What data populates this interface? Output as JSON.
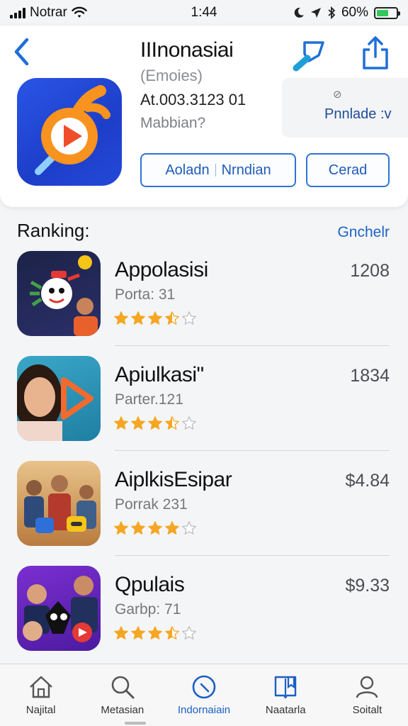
{
  "status": {
    "carrier": "Notrar",
    "time": "1:44",
    "battery_text": "60%",
    "battery_level": 0.6,
    "battery_color": "#34c759",
    "icons": [
      "signal-icon",
      "wifi-icon",
      "moon-icon",
      "location-icon",
      "bluetooth-icon",
      "battery-icon"
    ]
  },
  "header": {
    "app_name": "IIInonasiai",
    "subtitle": "(Emoies)",
    "meta": "At.003.3123 01",
    "developer": "Mabbian?",
    "side_mark": "⊘",
    "side_label": "Pnnlade :v",
    "btn_left": "Aoladn",
    "btn_right": "Nrndian",
    "btn_cerad": "Cerad",
    "icons": [
      "back-chevron-icon",
      "paint-brush-icon",
      "share-icon",
      "app-play-icon"
    ],
    "accent": "#2f74d6"
  },
  "ranking": {
    "title": "Ranking:",
    "link": "Gnchelr",
    "items": [
      {
        "title": "Appolasisi",
        "subtitle": "Porta: 31",
        "price": "1208",
        "rating": 3.5
      },
      {
        "title": "Apiulkasi\"",
        "subtitle": "Parter.121",
        "price": "1834",
        "rating": 3.5
      },
      {
        "title": "AiplkisEsipar",
        "subtitle": "Porrak 231",
        "price": "$4.84",
        "rating": 4
      },
      {
        "title": "Qpulais",
        "subtitle": "Garbp: 71",
        "price": "$9.33",
        "rating": 3.5
      }
    ],
    "star_color": "#f5a623"
  },
  "tabs": [
    {
      "label": "Najital",
      "icon": "home-icon"
    },
    {
      "label": "Metasian",
      "icon": "search-icon"
    },
    {
      "label": "Indornaiain",
      "icon": "discover-icon"
    },
    {
      "label": "Naatarla",
      "icon": "book-icon"
    },
    {
      "label": "Soitalt",
      "icon": "person-icon"
    }
  ]
}
